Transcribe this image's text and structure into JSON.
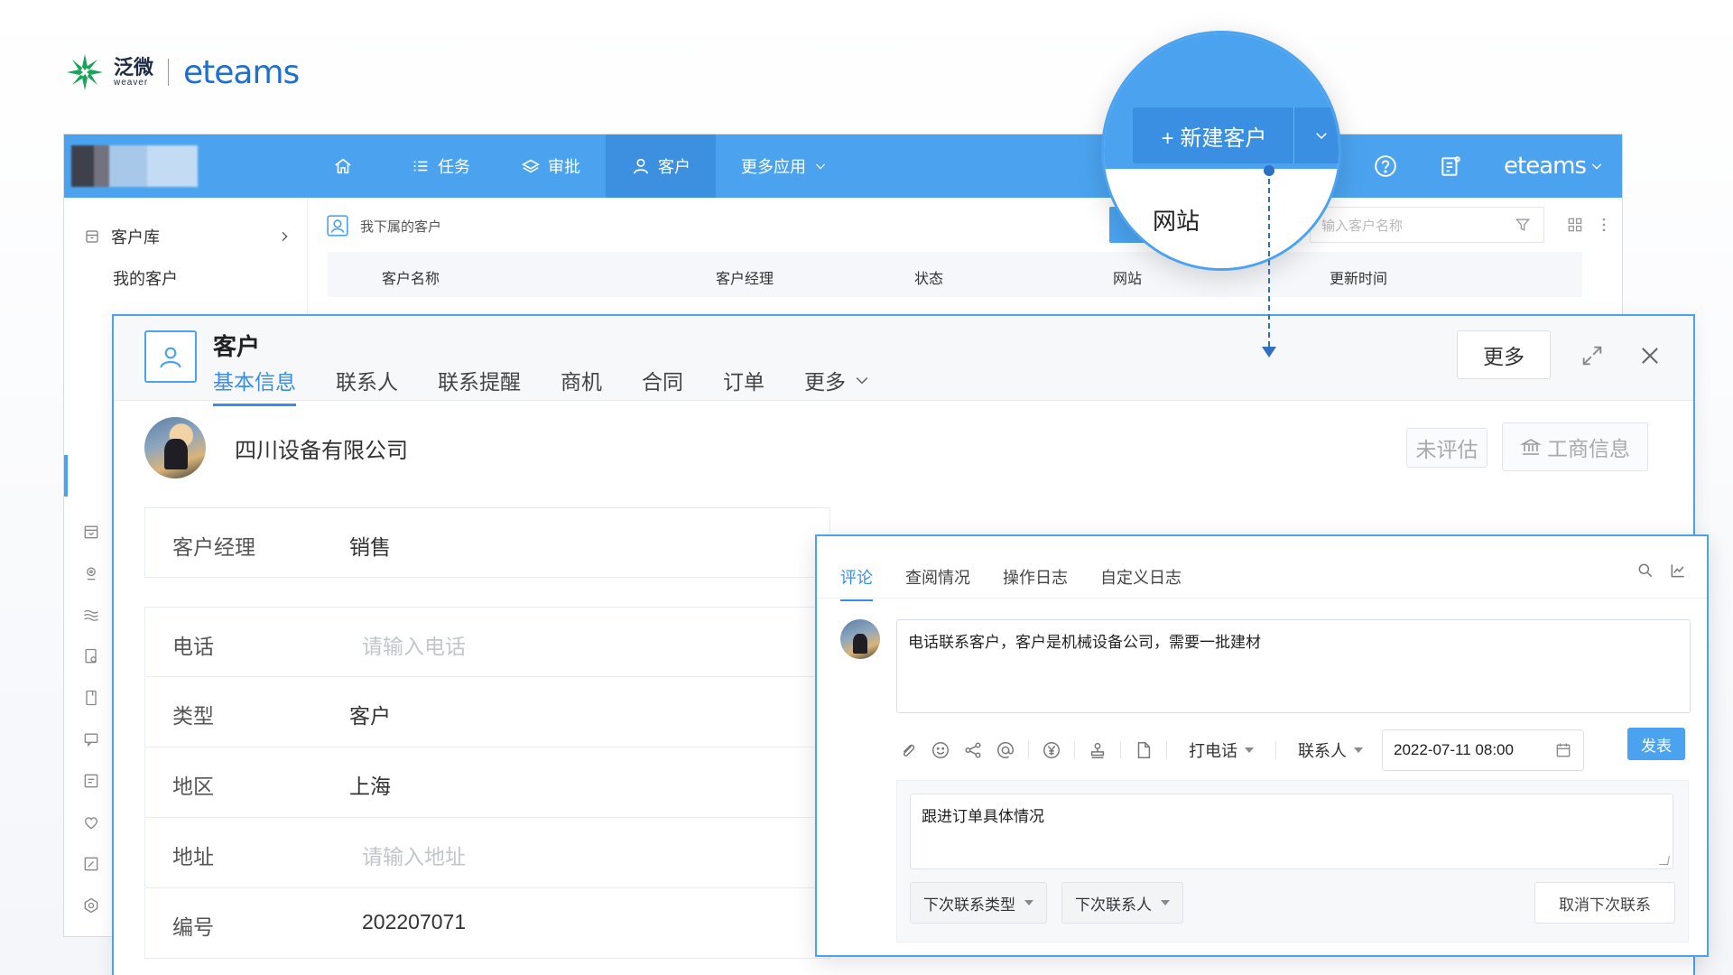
{
  "logo": {
    "cn": "泛微",
    "cn_sub": "weaver",
    "en": "eteams"
  },
  "topbar": {
    "nav": [
      {
        "label": ""
      },
      {
        "label": "任务"
      },
      {
        "label": "审批"
      },
      {
        "label": "客户"
      },
      {
        "label": "更多应用"
      }
    ],
    "brand": "eteams"
  },
  "sidebar": {
    "library": "客户库",
    "my_customers": "我的客户"
  },
  "list": {
    "header": "我下属的客户",
    "search_placeholder": "输入客户名称",
    "columns": [
      "客户名称",
      "客户经理",
      "状态",
      "网站",
      "更新时间"
    ]
  },
  "magnifier": {
    "new_customer": "+ 新建客户",
    "menu_item": "网站"
  },
  "card": {
    "title": "客户",
    "tabs": [
      "基本信息",
      "联系人",
      "联系提醒",
      "商机",
      "合同",
      "订单",
      "更多"
    ],
    "more_button": "更多",
    "company": "四川设备有限公司",
    "unrated": "未评估",
    "business_info": "工商信息",
    "fields": [
      {
        "label": "客户经理",
        "value": "销售",
        "placeholder": false
      },
      {
        "label": "电话",
        "value": "请输入电话",
        "placeholder": true
      },
      {
        "label": "类型",
        "value": "客户",
        "placeholder": false
      },
      {
        "label": "地区",
        "value": "上海",
        "placeholder": false
      },
      {
        "label": "地址",
        "value": "请输入地址",
        "placeholder": true
      },
      {
        "label": "编号",
        "value": "202207071",
        "placeholder": false
      }
    ]
  },
  "panel": {
    "tabs": [
      "评论",
      "查阅情况",
      "操作日志",
      "自定义日志"
    ],
    "comment": "电话联系客户，客户是机械设备公司，需要一批建材",
    "call_type": "打电话",
    "contact": "联系人",
    "datetime": "2022-07-11 08:00",
    "post": "发表",
    "next_note": "跟进订单具体情况",
    "next_type": "下次联系类型",
    "next_contact": "下次联系人",
    "cancel_next": "取消下次联系"
  },
  "colors": {
    "primary": "#4ba3ef",
    "active_tab": "#3a8ee6",
    "dashed": "#2f6fc4"
  }
}
